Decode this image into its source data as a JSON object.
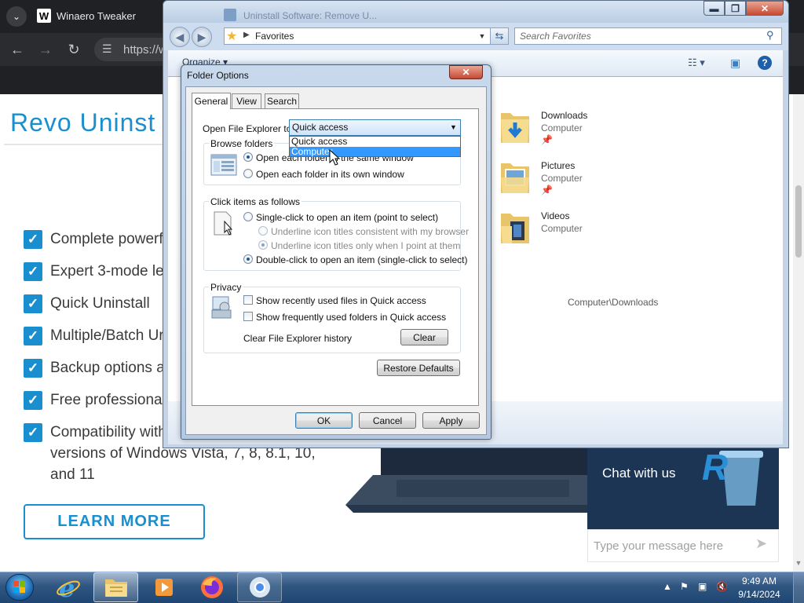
{
  "browser": {
    "tab_list_icon": "chevron-down-icon",
    "tab_favicon": "W",
    "tab_title": "Winaero Tweaker",
    "url": "https://w",
    "back_icon": "←",
    "forward_icon": "→",
    "reload_icon": "↻",
    "site_info_icon": "tune-icon"
  },
  "website": {
    "logo_text": "Revo Uninst",
    "features": [
      {
        "text": "Complete powerf"
      },
      {
        "text": "Expert 3-mode le"
      },
      {
        "text": "Quick Uninstall"
      },
      {
        "text": "Multiple/Batch Ur"
      },
      {
        "text": "Backup options a"
      },
      {
        "text": "Free professional"
      },
      {
        "text": "Compatibility with\nversions of Windows Vista, 7, 8, 8.1, 10,\nand 11"
      }
    ],
    "learn_more": "LEARN MORE",
    "accent_color": "#1a8fcf"
  },
  "chat": {
    "title": "Chat with us",
    "input_placeholder": "Type your message here",
    "send_icon": "send-icon"
  },
  "explorer": {
    "tab_title": "Uninstall Software: Remove U...",
    "address": "Favorites",
    "search_placeholder": "Search Favorites",
    "organize": "Organize ▾",
    "favorites": [
      {
        "name": "Downloads",
        "location": "Computer"
      },
      {
        "name": "Pictures",
        "location": "Computer"
      },
      {
        "name": "Videos",
        "location": "Computer"
      }
    ],
    "status_path": "Computer\\Downloads"
  },
  "dialog": {
    "title": "Folder Options",
    "tabs": [
      "General",
      "View",
      "Search"
    ],
    "active_tab": "General",
    "open_explorer_label": "Open File Explorer to:",
    "open_explorer_value": "Quick access",
    "dropdown_options": [
      "Quick access",
      "Computer"
    ],
    "dropdown_highlighted": "Computer",
    "browse_folders": {
      "title": "Browse folders",
      "options": [
        "Open each folder in the same window",
        "Open each folder in its own window"
      ],
      "selected": 0
    },
    "click_items": {
      "title": "Click items as follows",
      "single_click": "Single-click to open an item (point to select)",
      "underline_browser": "Underline icon titles consistent with my browser",
      "underline_point": "Underline icon titles only when I point at them",
      "double_click": "Double-click to open an item (single-click to select)",
      "selected": "double_click"
    },
    "privacy": {
      "title": "Privacy",
      "show_recent_files": "Show recently used files in Quick access",
      "show_frequent_folders": "Show frequently used folders in Quick access",
      "show_recent_files_checked": false,
      "show_frequent_folders_checked": false,
      "clear_history_label": "Clear File Explorer history",
      "clear_button": "Clear"
    },
    "restore_defaults": "Restore Defaults",
    "ok": "OK",
    "cancel": "Cancel",
    "apply": "Apply"
  },
  "taskbar": {
    "time": "9:49 AM",
    "date": "9/14/2024",
    "pinned": [
      "internet-explorer-icon",
      "file-explorer-icon",
      "media-player-icon",
      "firefox-icon",
      "chrome-icon"
    ]
  }
}
